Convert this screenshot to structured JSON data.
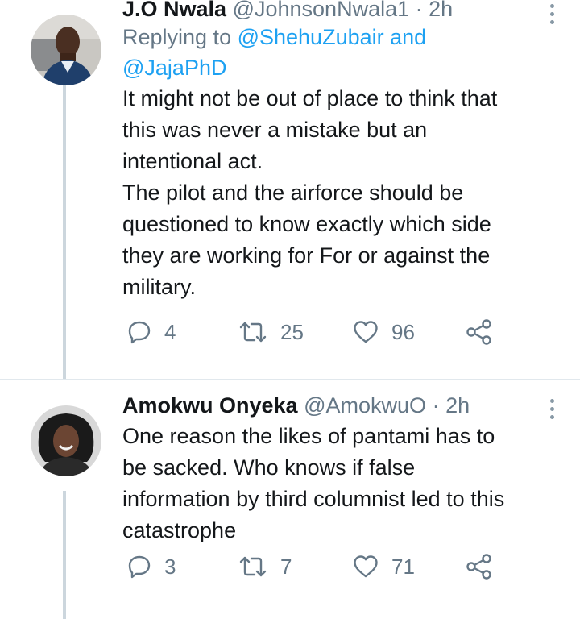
{
  "tweets": [
    {
      "name": "J.O Nwala",
      "handle": "@JohnsonNwala1",
      "separator": "·",
      "time": "2h",
      "reply_prefix": "Replying to ",
      "reply_mention_1": "@ShehuZubair",
      "reply_and": " and",
      "reply_mention_2": "@JajaPhD",
      "text": "It might not be out of place to think that\nthis was never a mistake but an\nintentional act.\nThe pilot and the airforce should be\nquestioned to know exactly which side\nthey are working for For or against the\nmilitary.",
      "replies": "4",
      "retweets": "25",
      "likes": "96"
    },
    {
      "name": "Amokwu Onyeka",
      "handle": "@AmokwuO",
      "separator": "·",
      "time": "2h",
      "text": "One reason the likes of pantami has to\nbe sacked. Who knows if false\ninformation by third columnist led to this\ncatastrophe",
      "replies": "3",
      "retweets": "7",
      "likes": "71"
    }
  ],
  "icons": {
    "reply": "reply-icon",
    "retweet": "retweet-icon",
    "like": "heart-icon",
    "share": "share-icon",
    "more": "more-options-icon"
  },
  "colors": {
    "text": "#14171a",
    "secondary": "#657786",
    "mention": "#1da1f2",
    "thread_line": "#ccd6dd"
  }
}
